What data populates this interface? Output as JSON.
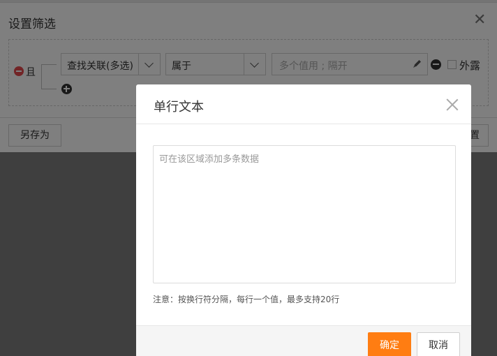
{
  "background_dialog": {
    "title": "设置筛选",
    "logic_label": "且",
    "field_select": "查找关联(多选)",
    "operator_select": "属于",
    "value_placeholder": "多个值用 ; 隔开",
    "exposed_label": "外露",
    "save_as_label": "另存为",
    "reset_label_partial": "置"
  },
  "modal": {
    "title": "单行文本",
    "textarea_placeholder": "可在该区域添加多条数据",
    "note": "注意：按换行符分隔，每行一个值，最多支持20行",
    "ok_label": "确定",
    "cancel_label": "取消"
  },
  "colors": {
    "accent": "#ff7d12",
    "overlay": "rgba(0,0,0,0.5)",
    "remove_red": "#e5484d"
  },
  "icons": {
    "close": "close-icon",
    "remove": "minus-circle-icon",
    "add": "plus-circle-icon",
    "edit": "pencil-icon",
    "dropdown": "chevron-down-icon"
  }
}
